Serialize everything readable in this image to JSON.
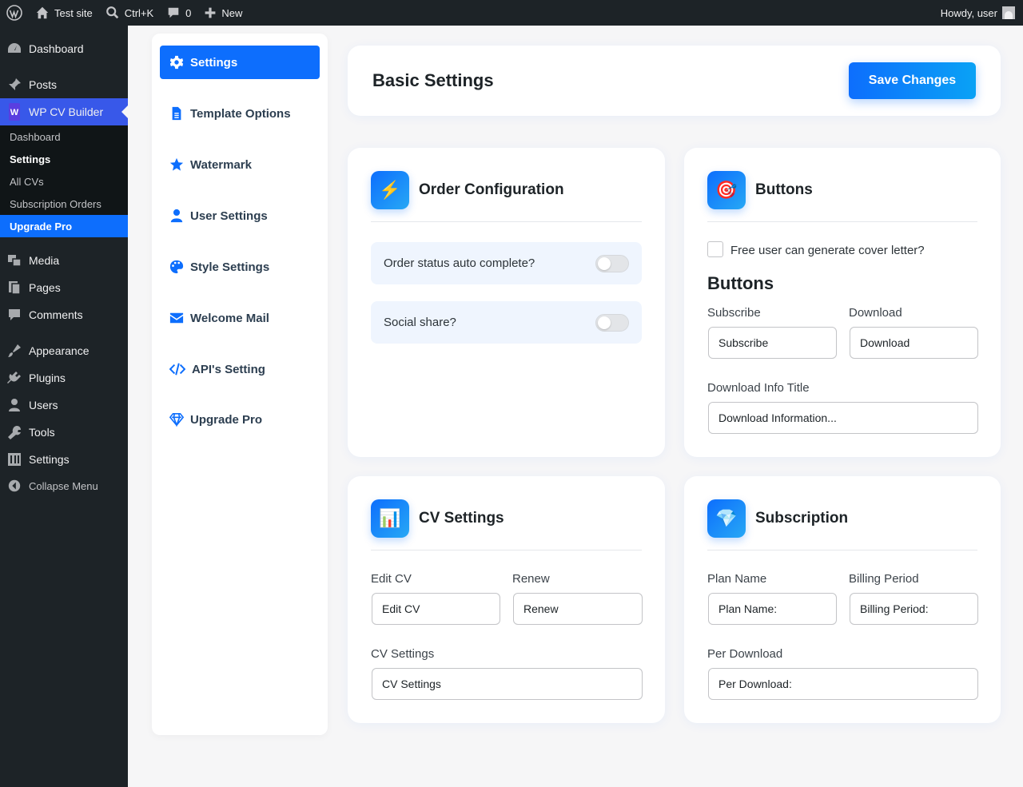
{
  "adminbar": {
    "site_name": "Test site",
    "search_shortcut": "Ctrl+K",
    "comments_count": "0",
    "new_label": "New",
    "greeting": "Howdy, user"
  },
  "sidebar": {
    "items": [
      {
        "label": "Dashboard",
        "icon": "dashboard-icon"
      },
      {
        "label": "Posts",
        "icon": "pin-icon"
      },
      {
        "label": "WP CV Builder",
        "icon": "cv-builder-logo-icon"
      },
      {
        "label": "Media",
        "icon": "media-icon"
      },
      {
        "label": "Pages",
        "icon": "pages-icon"
      },
      {
        "label": "Comments",
        "icon": "comment-icon"
      },
      {
        "label": "Appearance",
        "icon": "brush-icon"
      },
      {
        "label": "Plugins",
        "icon": "plug-icon"
      },
      {
        "label": "Users",
        "icon": "user-icon"
      },
      {
        "label": "Tools",
        "icon": "wrench-icon"
      },
      {
        "label": "Settings",
        "icon": "settings-sliders-icon"
      }
    ],
    "submenu": [
      "Dashboard",
      "Settings",
      "All CVs",
      "Subscription Orders",
      "Upgrade Pro"
    ],
    "collapse_label": "Collapse Menu"
  },
  "nav": {
    "items": [
      {
        "label": "Settings",
        "icon": "gear-icon"
      },
      {
        "label": "Template Options",
        "icon": "file-icon"
      },
      {
        "label": "Watermark",
        "icon": "star-icon"
      },
      {
        "label": "User Settings",
        "icon": "user-icon"
      },
      {
        "label": "Style Settings",
        "icon": "palette-icon"
      },
      {
        "label": "Welcome Mail",
        "icon": "envelope-icon"
      },
      {
        "label": "API's Setting",
        "icon": "code-icon"
      },
      {
        "label": "Upgrade Pro",
        "icon": "diamond-icon"
      }
    ]
  },
  "header": {
    "title": "Basic Settings",
    "save_label": "Save Changes"
  },
  "order_card": {
    "title": "Order Configuration",
    "icon": "⚡",
    "toggles": [
      {
        "label": "Order status auto complete?",
        "on": false
      },
      {
        "label": "Social share?",
        "on": false
      }
    ]
  },
  "buttons_card": {
    "title": "Buttons",
    "icon": "🎯",
    "checkbox_label": "Free user can generate cover letter?",
    "checkbox_checked": false,
    "section_heading": "Buttons",
    "subscribe_label": "Subscribe",
    "subscribe_value": "Subscribe",
    "download_label": "Download",
    "download_value": "Download",
    "info_title_label": "Download Info Title",
    "info_title_value": "Download Information..."
  },
  "cv_card": {
    "title": "CV Settings",
    "icon": "📊",
    "edit_label": "Edit CV",
    "edit_value": "Edit CV",
    "renew_label": "Renew",
    "renew_value": "Renew",
    "cv_settings_label": "CV Settings",
    "cv_settings_value": "CV Settings"
  },
  "subscription_card": {
    "title": "Subscription",
    "icon": "💎",
    "plan_label": "Plan Name",
    "plan_value": "Plan Name:",
    "billing_label": "Billing Period",
    "billing_value": "Billing Period:",
    "per_download_label": "Per Download",
    "per_download_value": "Per Download:"
  },
  "colors": {
    "accent": "#0d6efd",
    "admin_bg": "#1d2327",
    "toggle_row_bg": "#eff5fe"
  }
}
